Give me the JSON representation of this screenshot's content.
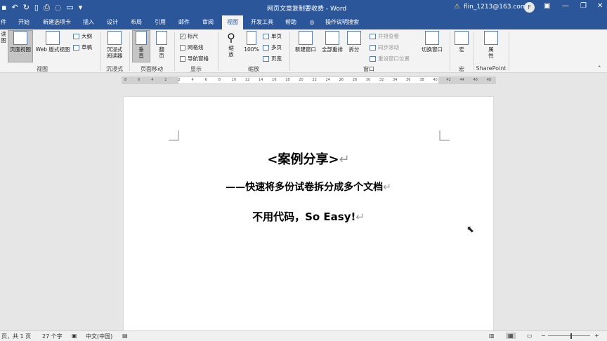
{
  "window": {
    "title": "网页文章复制要收费 - Word",
    "account": "flin_1213@163.com",
    "avatar_initial": "F"
  },
  "tabs": [
    "件",
    "开始",
    "新建选项卡",
    "插入",
    "设计",
    "布局",
    "引用",
    "邮件",
    "审阅",
    "视图",
    "开发工具",
    "帮助",
    "操作说明搜索"
  ],
  "active_tab": "视图",
  "ribbon": {
    "views": {
      "label": "视图",
      "read_mode": "读\n图",
      "print_layout": "页面视图",
      "web_layout": "Web 版式视图",
      "outline": "大纲",
      "draft": "草稿"
    },
    "immersive": {
      "label": "沉浸式",
      "reader": "沉浸式\n阅读器"
    },
    "page_movement": {
      "label": "页面移动",
      "vertical": "垂\n直",
      "side_to_side": "翻\n页"
    },
    "show": {
      "label": "显示",
      "ruler": "标尺",
      "ruler_checked": true,
      "gridlines": "网格线",
      "gridlines_checked": false,
      "nav_pane": "导航窗格",
      "nav_pane_checked": false
    },
    "zoom": {
      "label": "缩放",
      "zoom": "缩\n放",
      "hundred": "100%",
      "one_page": "单页",
      "multi_page": "多页",
      "page_width": "页宽"
    },
    "window": {
      "label": "窗口",
      "new_window": "新建窗口",
      "arrange_all": "全部重排",
      "split": "拆分",
      "side_by_side": "并排查看",
      "sync_scroll": "同步滚动",
      "reset_pos": "重设窗口位置",
      "switch": "切换窗口"
    },
    "macros": {
      "label": "宏",
      "macro": "宏"
    },
    "sharepoint": {
      "label": "SharePoint",
      "properties": "属\n性"
    }
  },
  "ruler_ticks": [
    "8",
    "6",
    "4",
    "2",
    "2",
    "4",
    "6",
    "8",
    "10",
    "12",
    "14",
    "16",
    "18",
    "20",
    "22",
    "24",
    "26",
    "28",
    "30",
    "32",
    "34",
    "36",
    "38",
    "40",
    "42",
    "44",
    "46",
    "48"
  ],
  "document": {
    "line1": "<案例分享>",
    "line2": "——快速将多份试卷拆分成多个文档",
    "line3": "不用代码，So Easy!",
    "para_mark": "↵"
  },
  "status": {
    "page": "页，共 1 页",
    "words": "27 个字",
    "language": "中文(中国)"
  }
}
